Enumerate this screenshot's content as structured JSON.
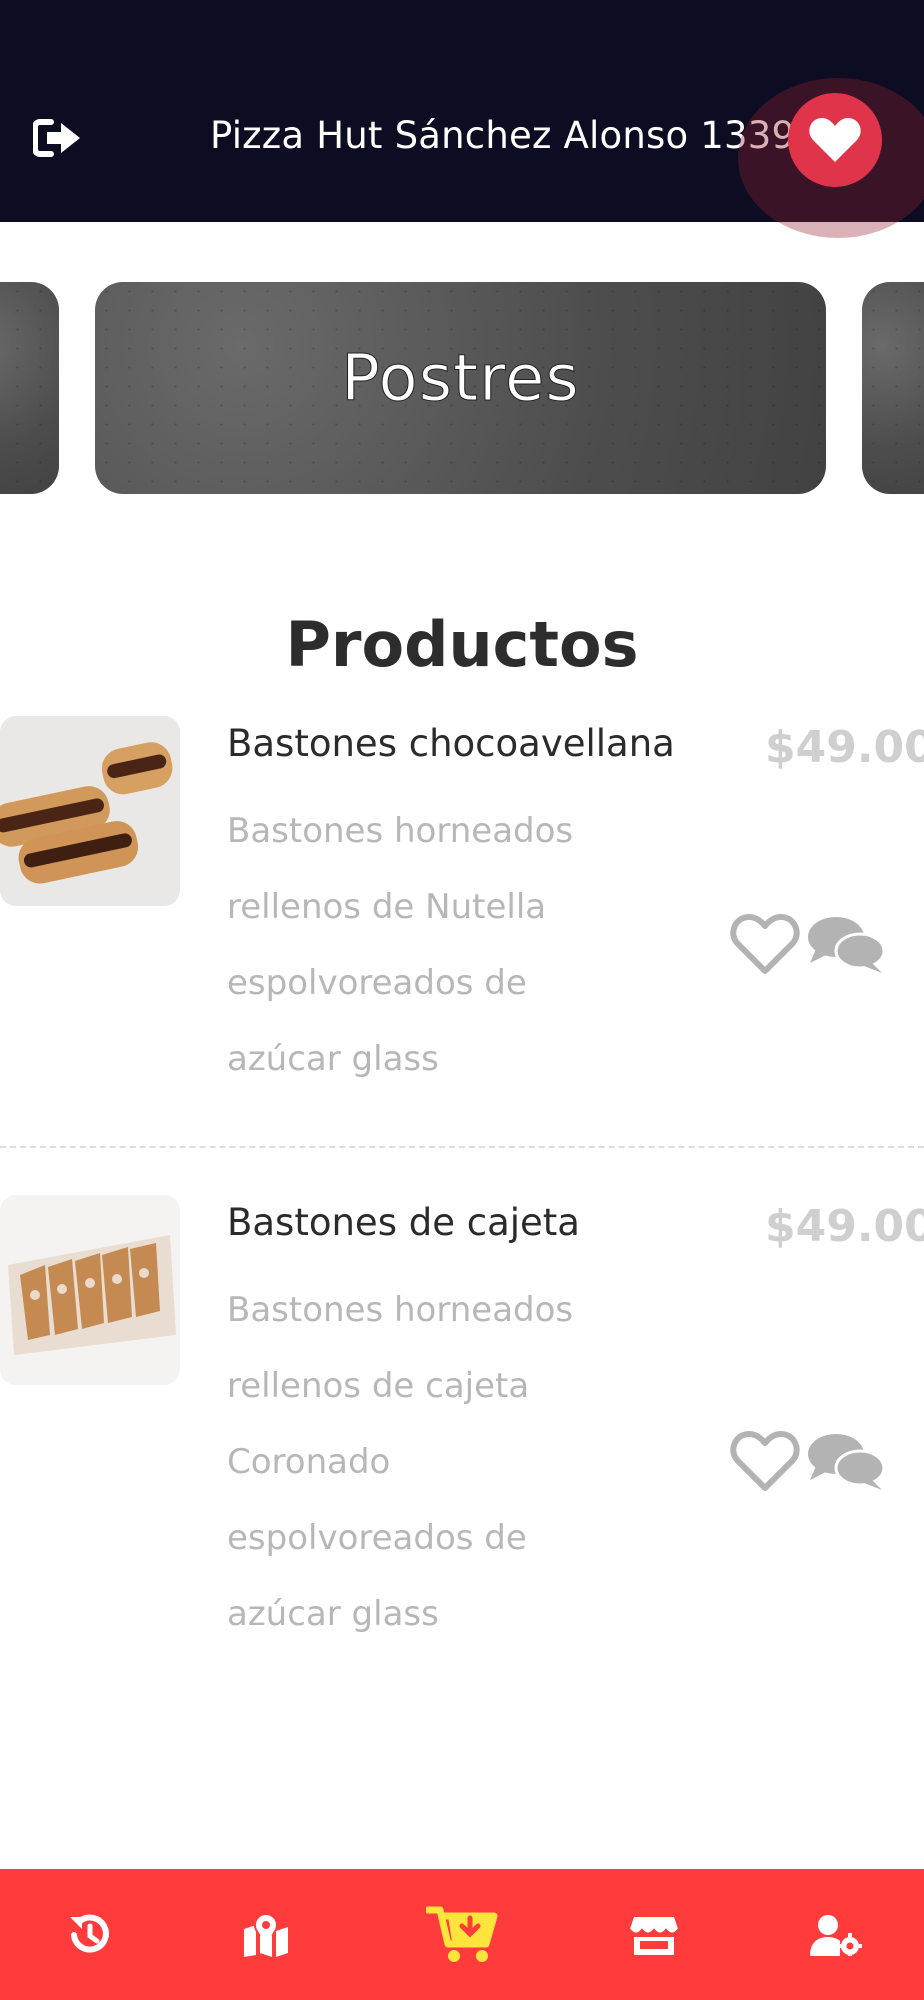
{
  "header": {
    "store_name": "Pizza Hut Sánchez Alonso 1339",
    "logout_icon": "sign-out-icon",
    "favorite_icon": "heart-icon",
    "favorite_color": "#e0344a"
  },
  "categories": {
    "active_label": "Postres"
  },
  "products_section": {
    "title": "Productos",
    "items": [
      {
        "name": "Bastones chocoavellana",
        "price": "$49.00",
        "description": "Bastones horneados rellenos de Nutella espolvoreados de azúcar glass",
        "desc_lines": [
          "Bastones horneados",
          "rellenos de Nutella",
          "espolvoreados de",
          "azúcar glass"
        ]
      },
      {
        "name": "Bastones de cajeta",
        "price": "$49.00",
        "description": "Bastones horneados rellenos de cajeta Coronado espolvoreados de azúcar glass",
        "desc_lines": [
          "Bastones horneados",
          "rellenos de cajeta",
          "Coronado",
          "espolvoreados de",
          "azúcar glass"
        ]
      }
    ]
  },
  "bottom_nav": {
    "background": "#ff3b3b",
    "active_color": "#ffe53b",
    "items": [
      {
        "icon": "history-icon"
      },
      {
        "icon": "map-marker-icon"
      },
      {
        "icon": "cart-download-icon",
        "active": true
      },
      {
        "icon": "store-icon"
      },
      {
        "icon": "user-settings-icon"
      }
    ]
  }
}
